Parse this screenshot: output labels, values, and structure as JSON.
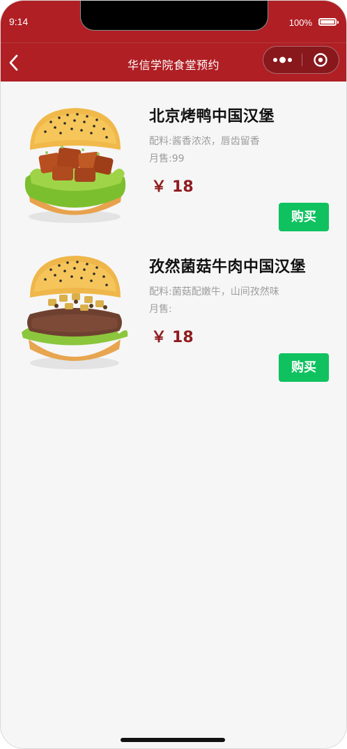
{
  "status_bar": {
    "time": "9:14",
    "battery": "100%"
  },
  "nav": {
    "title": "华信学院食堂预约"
  },
  "menu": {
    "items": [
      {
        "name": "北京烤鸭中国汉堡",
        "ingredients": "配料:酱香浓浓，唇齿留香",
        "sales": "月售:99",
        "currency": "￥",
        "price": "18",
        "buy_label": "购买",
        "image_icon": "duck-burger-image"
      },
      {
        "name": "孜然菌菇牛肉中国汉堡",
        "ingredients": "配料:菌菇配嫩牛，山间孜然味",
        "sales": "月售:",
        "currency": "￥",
        "price": "18",
        "buy_label": "购买",
        "image_icon": "mushroom-beef-burger-image"
      }
    ]
  },
  "colors": {
    "header": "#af1f24",
    "price": "#8e1b1f",
    "buy_button": "#0fc25f",
    "background": "#f6f6f6"
  }
}
